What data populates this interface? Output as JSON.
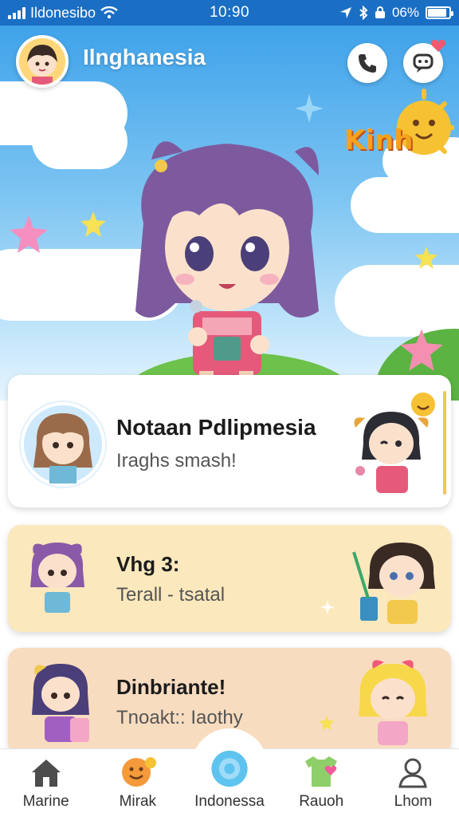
{
  "status_bar": {
    "carrier": "Ildonesibo",
    "time": "10:90",
    "battery_text": "06%",
    "battery_level": 0.9
  },
  "header": {
    "title": "Ilnghanesia",
    "phone_icon": "phone-icon",
    "chat_icon": "chat-bubble-icon",
    "logo_text": "Kinh"
  },
  "cards": [
    {
      "title": "Notaan Pdlipmesia",
      "subtitle": "Iraghs smash!"
    },
    {
      "title": "Vhg 3:",
      "subtitle": "Terall - tsatal"
    },
    {
      "title": "Dinbriante!",
      "subtitle": "Tnoakt:: Iaothy"
    }
  ],
  "nav": {
    "items": [
      {
        "label": "Marine",
        "icon": "home-icon"
      },
      {
        "label": "Mirak",
        "icon": "smile-face-icon"
      },
      {
        "label": "Indonessa",
        "icon": "flower-badge-icon"
      },
      {
        "label": "Rauoh",
        "icon": "shirt-heart-icon"
      },
      {
        "label": "Lhom",
        "icon": "profile-icon"
      }
    ]
  },
  "colors": {
    "status_bar": "#1a6fc4",
    "sky": "#3fa3ea",
    "card_yellow": "#fbe8bd",
    "card_peach": "#f8dcc0",
    "accent_purple": "#8a5aa8"
  }
}
